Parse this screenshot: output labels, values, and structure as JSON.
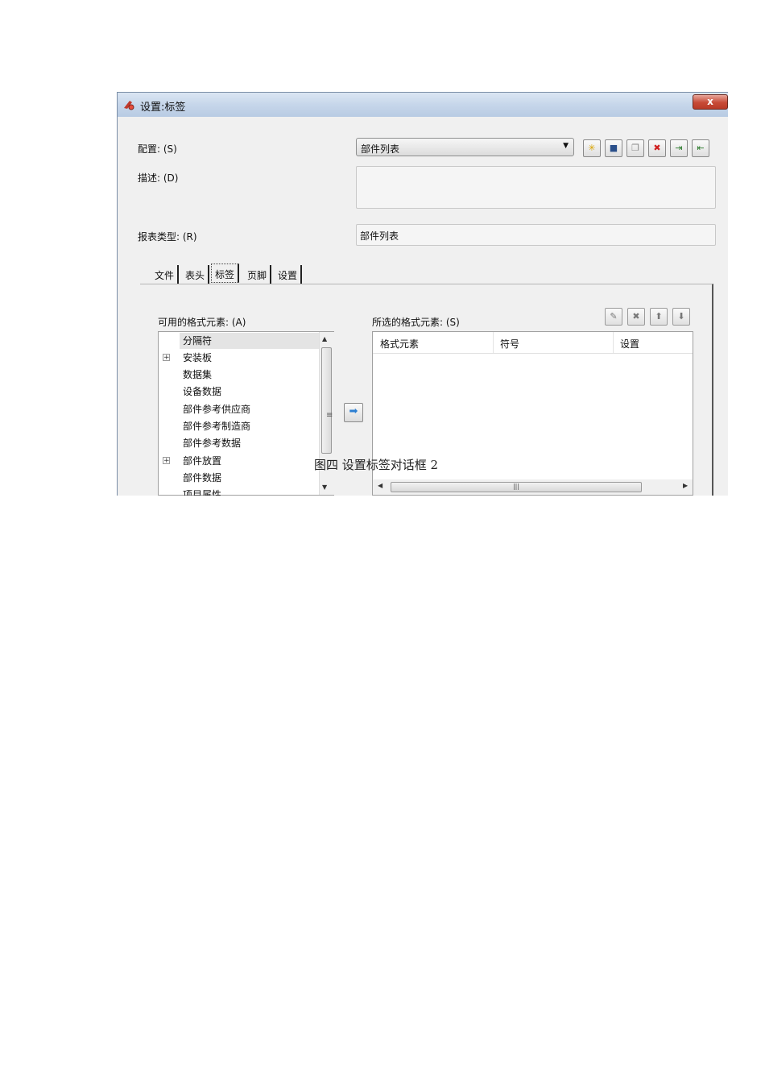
{
  "window": {
    "title": "设置:标签",
    "close_label": "x"
  },
  "form": {
    "config_label": "配置: (S)",
    "config_value": "部件列表",
    "description_label": "描述: (D)",
    "description_value": "",
    "report_type_label": "报表类型: (R)",
    "report_type_value": "部件列表"
  },
  "toolbar": {
    "icons": [
      "new-icon",
      "save-icon",
      "copy-icon",
      "delete-icon",
      "import-icon",
      "export-icon"
    ]
  },
  "tabs": [
    {
      "label": "文件",
      "active": false
    },
    {
      "label": "表头",
      "active": false
    },
    {
      "label": "标签",
      "active": true
    },
    {
      "label": "页脚",
      "active": false
    },
    {
      "label": "设置",
      "active": false
    }
  ],
  "available": {
    "label": "可用的格式元素: (A)",
    "items": [
      {
        "label": "分隔符",
        "selected": true,
        "expandable": false
      },
      {
        "label": "安装板",
        "selected": false,
        "expandable": true
      },
      {
        "label": "数据集",
        "selected": false,
        "expandable": false
      },
      {
        "label": "设备数据",
        "selected": false,
        "expandable": false
      },
      {
        "label": "部件参考供应商",
        "selected": false,
        "expandable": false
      },
      {
        "label": "部件参考制造商",
        "selected": false,
        "expandable": false
      },
      {
        "label": "部件参考数据",
        "selected": false,
        "expandable": false
      },
      {
        "label": "部件放置",
        "selected": false,
        "expandable": true
      },
      {
        "label": "部件数据",
        "selected": false,
        "expandable": false
      },
      {
        "label": "项目属性",
        "selected": false,
        "expandable": false
      }
    ]
  },
  "selected": {
    "label": "所选的格式元素: (S)",
    "columns": [
      "格式元素",
      "符号",
      "设置"
    ]
  },
  "caption": "图四  设置标签对话框 2"
}
